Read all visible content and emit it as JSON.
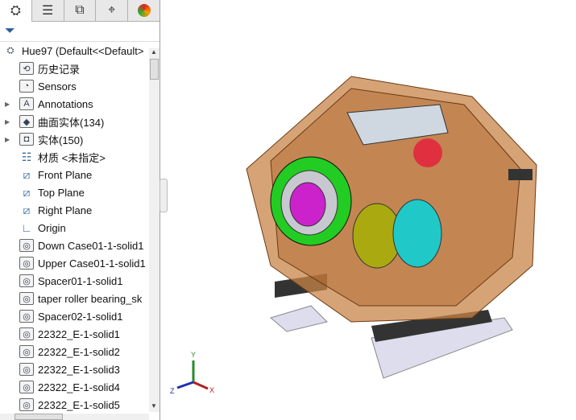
{
  "tabs": [
    {
      "icon": "feature-manager-icon"
    },
    {
      "icon": "property-manager-icon"
    },
    {
      "icon": "configuration-manager-icon"
    },
    {
      "icon": "dimxpert-icon"
    },
    {
      "icon": "display-manager-icon"
    }
  ],
  "root": "Hue97  (Default<<Default>",
  "items": [
    {
      "label": "历史记录",
      "icon": "history-folder-icon",
      "expand": false
    },
    {
      "label": "Sensors",
      "icon": "sensors-folder-icon",
      "expand": false
    },
    {
      "label": "Annotations",
      "icon": "annotations-folder-icon",
      "expand": true
    },
    {
      "label": "曲面实体(134)",
      "icon": "surface-bodies-folder-icon",
      "expand": true
    },
    {
      "label": "实体(150)",
      "icon": "solid-bodies-folder-icon",
      "expand": true
    },
    {
      "label": "材质 <未指定>",
      "icon": "material-icon",
      "expand": false
    },
    {
      "label": "Front Plane",
      "icon": "plane-icon",
      "expand": false
    },
    {
      "label": "Top Plane",
      "icon": "plane-icon",
      "expand": false
    },
    {
      "label": "Right Plane",
      "icon": "plane-icon",
      "expand": false
    },
    {
      "label": "Origin",
      "icon": "origin-icon",
      "expand": false
    },
    {
      "label": "Down Case01-1-solid1",
      "icon": "solid-body-icon",
      "expand": false
    },
    {
      "label": "Upper Case01-1-solid1",
      "icon": "solid-body-icon",
      "expand": false
    },
    {
      "label": "Spacer01-1-solid1",
      "icon": "solid-body-icon",
      "expand": false
    },
    {
      "label": "taper roller bearing_sk",
      "icon": "solid-body-icon",
      "expand": false
    },
    {
      "label": "Spacer02-1-solid1",
      "icon": "solid-body-icon",
      "expand": false
    },
    {
      "label": "22322_E-1-solid1",
      "icon": "solid-body-icon",
      "expand": false
    },
    {
      "label": "22322_E-1-solid2",
      "icon": "solid-body-icon",
      "expand": false
    },
    {
      "label": "22322_E-1-solid3",
      "icon": "solid-body-icon",
      "expand": false
    },
    {
      "label": "22322_E-1-solid4",
      "icon": "solid-body-icon",
      "expand": false
    },
    {
      "label": "22322_E-1-solid5",
      "icon": "solid-body-icon",
      "expand": false
    }
  ],
  "triad": {
    "x": "X",
    "y": "Y",
    "z": "Z"
  }
}
